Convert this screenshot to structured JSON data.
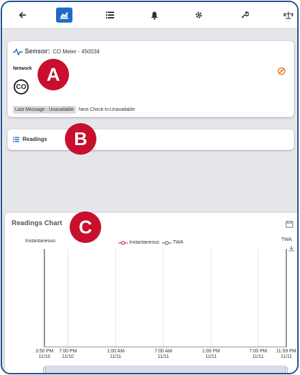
{
  "sensor": {
    "title_label": "Sensor:",
    "name": "CO Meter - 450034",
    "network_label": "Network",
    "icon_text": "CO",
    "last_message": "Last Message : Unavailable",
    "next_checkin": "Next Check-in:Unavailable"
  },
  "readings": {
    "label": "Readings"
  },
  "badges": {
    "a": "A",
    "b": "B",
    "c": "C"
  },
  "chart": {
    "title": "Readings Chart",
    "left_axis_label": "Instantaneous",
    "right_axis_label": "TWA",
    "legend": [
      {
        "label": "Instantaneous",
        "color": "#c8102e"
      },
      {
        "label": "TWA",
        "color": "#555555"
      }
    ]
  },
  "chart_data": {
    "type": "line",
    "title": "Readings Chart",
    "x": [
      "3:50 PM 11/10",
      "7:00 PM 11/10",
      "1:00 AM 11/11",
      "7:00 AM 11/11",
      "1:00 PM 11/11",
      "7:00 PM 11/11",
      "11:59 PM 11/11"
    ],
    "x_ticks": [
      {
        "time": "3:50 PM",
        "date": "11/10"
      },
      {
        "time": "7:00 PM",
        "date": "11/10"
      },
      {
        "time": "1:00 AM",
        "date": "11/11"
      },
      {
        "time": "7:00 AM",
        "date": "11/11"
      },
      {
        "time": "1:00 PM",
        "date": "11/11"
      },
      {
        "time": "7:00 PM",
        "date": "11/11"
      },
      {
        "time": "11:59 PM",
        "date": "11/11"
      }
    ],
    "series": [
      {
        "name": "Instantaneous",
        "values": []
      },
      {
        "name": "TWA",
        "values": []
      }
    ],
    "ylabel": "Instantaneous",
    "ylabel_right": "TWA",
    "grid": true,
    "legend_position": "top"
  },
  "colors": {
    "accent": "#1d6ec2",
    "badge": "#c8102e",
    "frame": "#1f4e8a",
    "alert_icon": "#e8741e"
  }
}
